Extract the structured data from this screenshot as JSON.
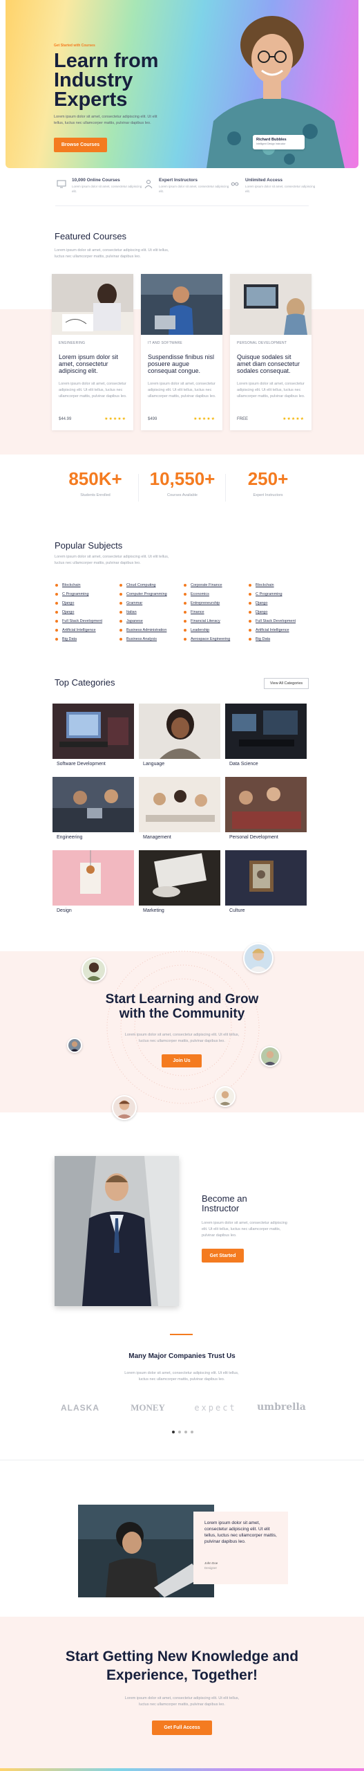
{
  "hero": {
    "kicker": "Get Started with Courses",
    "title_line1": "Learn from",
    "title_line2": "Industry",
    "title_line3": "Experts",
    "desc": "Lorem ipsum dolor sit amet, consectetur adipiscing elit. Ut elit tellus, luctus nec ullamcorper mattis, pulvinar dapibus leo.",
    "button": "Browse Courses",
    "instructor_name": "Richard Bubbles",
    "instructor_role": "Intelligent Design Instructor"
  },
  "features": [
    {
      "icon": "monitor-icon",
      "title": "10,000 Online Courses",
      "desc": "Lorem ipsum dolor sit amet, consectetur adipiscing elit."
    },
    {
      "icon": "teacher-icon",
      "title": "Expert Instructors",
      "desc": "Lorem ipsum dolor sit amet, consectetur adipiscing elit."
    },
    {
      "icon": "infinity-icon",
      "title": "Unlimited Access",
      "desc": "Lorem ipsum dolor sit amet, consectetur adipiscing elit."
    }
  ],
  "featured": {
    "title": "Featured Courses",
    "desc": "Lorem ipsum dolor sit amet, consectetur adipiscing elit. Ut elit tellus, luctus nec ullamcorper mattis, pulvinar dapibus leo.",
    "courses": [
      {
        "category": "ENGINEERING",
        "title": "Lorem ipsum dolor sit amet, consectetur adipiscing elit.",
        "desc": "Lorem ipsum dolor sit amet, consectetur adipiscing elit. Ut elit tellus, luctus nec ullamcorper mattis, pulvinar dapibus leo.",
        "price": "$44.99",
        "stars": "★★★★★"
      },
      {
        "category": "IT AND SOFTWARE",
        "title": "Suspendisse finibus nisl posuere augue consequat congue.",
        "desc": "Lorem ipsum dolor sit amet, consectetur adipiscing elit. Ut elit tellus, luctus nec ullamcorper mattis, pulvinar dapibus leo.",
        "price": "$499",
        "stars": "★★★★★"
      },
      {
        "category": "PERSONAL DEVELOPMENT",
        "title": "Quisque sodales sit amet diam consectetur sodales consequat.",
        "desc": "Lorem ipsum dolor sit amet, consectetur adipiscing elit. Ut elit tellus, luctus nec ullamcorper mattis, pulvinar dapibus leo.",
        "price": "FREE",
        "stars": "★★★★★"
      }
    ]
  },
  "stats": [
    {
      "number": "850K+",
      "label": "Students Enrolled"
    },
    {
      "number": "10,550+",
      "label": "Courses Available"
    },
    {
      "number": "250+",
      "label": "Expert Instructors"
    }
  ],
  "subjects": {
    "title": "Popular Subjects",
    "desc": "Lorem ipsum dolor sit amet, consectetur adipiscing elit. Ut elit tellus, luctus nec ullamcorper mattis, pulvinar dapibus leo.",
    "columns": [
      [
        "Blockchain",
        "C Programming",
        "Django",
        "Django",
        "Full Stack Development",
        "Artificial Intelligence",
        "Big Data"
      ],
      [
        "Cloud Computing",
        "Computer Programming",
        "Grammar",
        "Italian",
        "Japanese",
        "Business Administration",
        "Business Analysis"
      ],
      [
        "Corporate Finance",
        "Economics",
        "Entrepreneurship",
        "Finance",
        "Financial Literacy",
        "Leadership",
        "Aerospace Engineering"
      ],
      [
        "Blockchain",
        "C Programming",
        "Django",
        "Django",
        "Full Stack Development",
        "Artificial Intelligence",
        "Big Data"
      ]
    ]
  },
  "categories": {
    "title": "Top Categories",
    "button": "View All Categories",
    "items": [
      "Software Development",
      "Language",
      "Data Science",
      "Engineering",
      "Management",
      "Personal Development",
      "Design",
      "Marketing",
      "Culture"
    ]
  },
  "community": {
    "title_line1": "Start Learning and Grow",
    "title_line2": "with the Community",
    "desc": "Lorem ipsum dolor sit amet, consectetur adipiscing elit. Ut elit tellus, luctus nec ullamcorper mattis, pulvinar dapibus leo.",
    "button": "Join Us"
  },
  "instructor": {
    "title_line1": "Become an",
    "title_line2": "Instructor",
    "desc": "Lorem ipsum dolor sit amet, consectetur adipiscing elit. Ut elit tellus, luctus nec ullamcorper mattis, pulvinar dapibus leo.",
    "button": "Get Started"
  },
  "companies": {
    "title": "Many Major Companies Trust Us",
    "desc": "Lorem ipsum dolor sit amet, consectetur adipiscing elit. Ut elit tellus, luctus nec ullamcorper mattis, pulvinar dapibus leo.",
    "logos": [
      "ALASKA",
      "MONEY",
      "expect",
      "umbrella"
    ]
  },
  "testimonial": {
    "quote": "Lorem ipsum dolor sit amet, consectetur adipiscing elit. Ut elit tellus, luctus nec ullamcorper mattis, pulvinar dapibus leo.",
    "name": "John Doe",
    "role": "Designer"
  },
  "cta": {
    "title_line1": "Start Getting New Knowledge and",
    "title_line2": "Experience, Together!",
    "desc": "Lorem ipsum dolor sit amet, consectetur adipiscing elit. Ut elit tellus, luctus nec ullamcorper mattis, pulvinar dapibus leo.",
    "button": "Get Full Access"
  },
  "colors": {
    "accent": "#f47b20",
    "text": "#1e2440",
    "pink_band": "#fdf1ee"
  }
}
